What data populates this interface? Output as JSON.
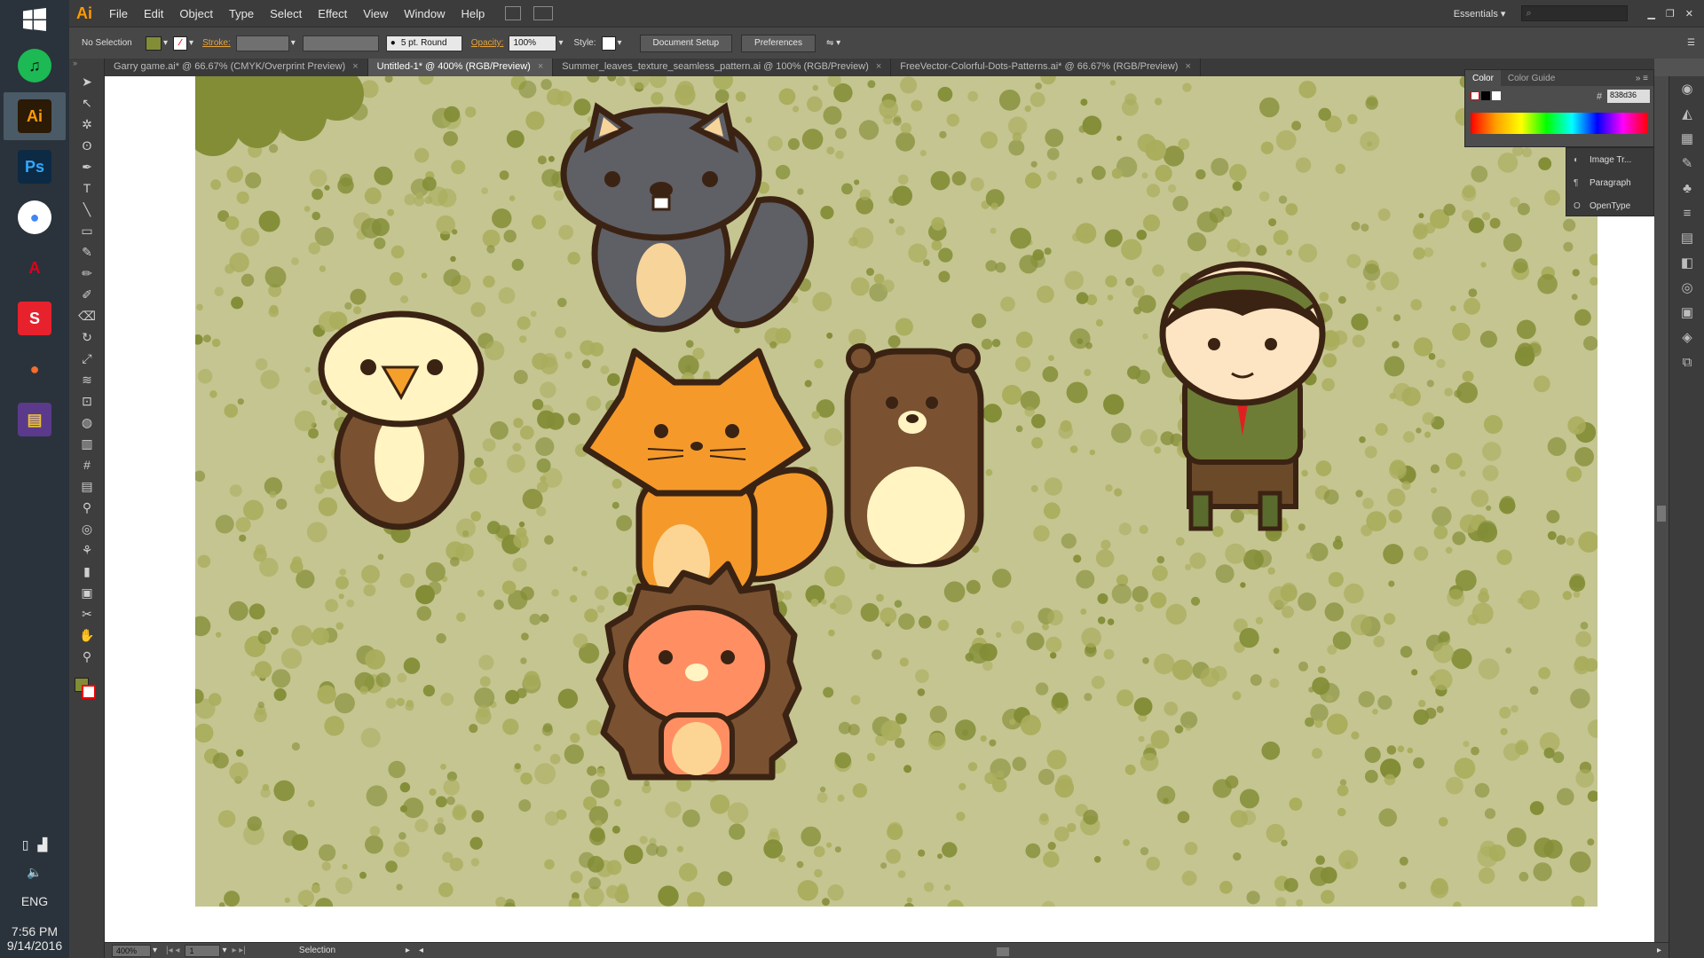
{
  "taskbar": {
    "apps": [
      {
        "name": "Spotify",
        "glyph": "♫",
        "color": "#1db954",
        "fg": "#111111"
      },
      {
        "name": "Illustrator",
        "glyph": "Ai",
        "color": "#2b1a06",
        "fg": "#ff9a00"
      },
      {
        "name": "Photoshop",
        "glyph": "Ps",
        "color": "#0d2a44",
        "fg": "#31a8ff"
      },
      {
        "name": "Chrome",
        "glyph": "●",
        "color": "#ffffff",
        "fg": "#4285f4"
      },
      {
        "name": "Acrobat",
        "glyph": "A",
        "color": "#2a333b",
        "fg": "#e0001b"
      },
      {
        "name": "SketchUp",
        "glyph": "S",
        "color": "#e8222d",
        "fg": "#ffffff"
      },
      {
        "name": "Origin",
        "glyph": "●",
        "color": "#2a333b",
        "fg": "#f56c2d"
      },
      {
        "name": "WinRAR",
        "glyph": "▤",
        "color": "#5b3a8c",
        "fg": "#e9c23b"
      }
    ],
    "lang": "ENG",
    "time": "7:56 PM",
    "date": "9/14/2016"
  },
  "menubar": {
    "logo": "Ai",
    "items": [
      "File",
      "Edit",
      "Object",
      "Type",
      "Select",
      "Effect",
      "View",
      "Window",
      "Help"
    ],
    "workspace": "Essentials",
    "search_placeholder": ""
  },
  "control": {
    "selection": "No Selection",
    "stroke_label": "Stroke:",
    "brush": "5 pt. Round",
    "opacity_label": "Opacity:",
    "opacity_value": "100%",
    "style_label": "Style:",
    "doc_setup": "Document Setup",
    "preferences": "Preferences",
    "fill_color": "#838d36"
  },
  "tabs": [
    {
      "label": "Garry game.ai* @ 66.67% (CMYK/Overprint Preview)",
      "active": false
    },
    {
      "label": "Untitled-1* @ 400% (RGB/Preview)",
      "active": true
    },
    {
      "label": "Summer_leaves_texture_seamless_pattern.ai @ 100% (RGB/Preview)",
      "active": false
    },
    {
      "label": "FreeVector-Colorful-Dots-Patterns.ai* @ 66.67% (RGB/Preview)",
      "active": false
    }
  ],
  "color_panel": {
    "tab_color": "Color",
    "tab_guide": "Color Guide",
    "hex_value": "838d36"
  },
  "mini_panel": {
    "items": [
      "Image Tr...",
      "Paragraph",
      "OpenType"
    ]
  },
  "status": {
    "zoom": "400%",
    "page": "1",
    "tool": "Selection"
  },
  "palette": {
    "bg": "#c5c591",
    "dot_dark": "#838d36",
    "dot_light": "#a9ad5c",
    "outline": "#3b2313"
  }
}
